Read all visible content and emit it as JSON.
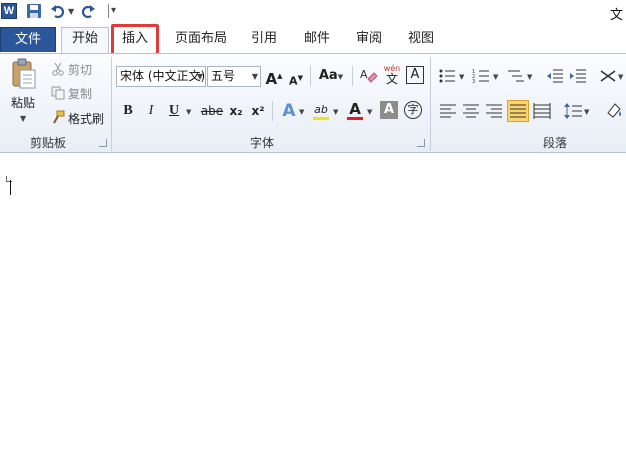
{
  "window": {
    "title": "文"
  },
  "quick_access": {
    "app_icon": "W",
    "save_icon": "save-icon",
    "undo_icon": "undo-icon",
    "redo_icon": "redo-icon"
  },
  "tabs": {
    "file": "文件",
    "home": "开始",
    "insert": "插入",
    "page_layout": "页面布局",
    "references": "引用",
    "mailings": "邮件",
    "review": "审阅",
    "view": "视图"
  },
  "clipboard": {
    "group_label": "剪贴板",
    "paste": "粘贴",
    "cut": "剪切",
    "copy": "复制",
    "format_painter": "格式刷"
  },
  "font": {
    "group_label": "字体",
    "font_name": "宋体 (中文正文)",
    "font_size": "五号",
    "grow": "A",
    "shrink": "A",
    "change_case": "Aa",
    "bold": "B",
    "italic": "I",
    "underline": "U",
    "strikethrough": "abe",
    "subscript": "x₂",
    "superscript": "x²",
    "text_effect": "A",
    "highlight": "ab",
    "font_color": "A",
    "char_shading": "A",
    "enclose": "字",
    "pinyin": "wén",
    "pinyin_char": "文",
    "clear_format": "A",
    "char_border": "A"
  },
  "paragraph": {
    "group_label": "段落"
  },
  "colors": {
    "accent": "#2b579a",
    "highlight_tab": "#e03b3b",
    "font_color_bar": "#e02020",
    "highlight_bar": "#f5e400",
    "justify_active": "#fbd66e"
  }
}
